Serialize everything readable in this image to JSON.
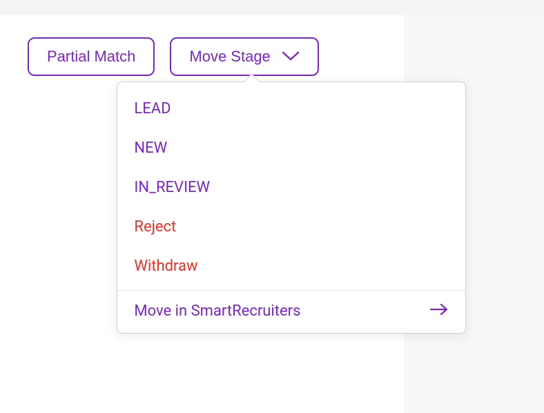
{
  "colors": {
    "primary": "#7a26c9",
    "danger": "#ef2e24",
    "border": "#d0d0d0"
  },
  "buttons": {
    "partial_match": "Partial Match",
    "move_stage": "Move Stage"
  },
  "dropdown": {
    "items": [
      {
        "label": "LEAD",
        "type": "stage"
      },
      {
        "label": "NEW",
        "type": "stage"
      },
      {
        "label": "IN_REVIEW",
        "type": "stage"
      },
      {
        "label": "Reject",
        "type": "danger"
      },
      {
        "label": "Withdraw",
        "type": "danger"
      }
    ],
    "action": {
      "label": "Move in SmartRecruiters"
    }
  }
}
